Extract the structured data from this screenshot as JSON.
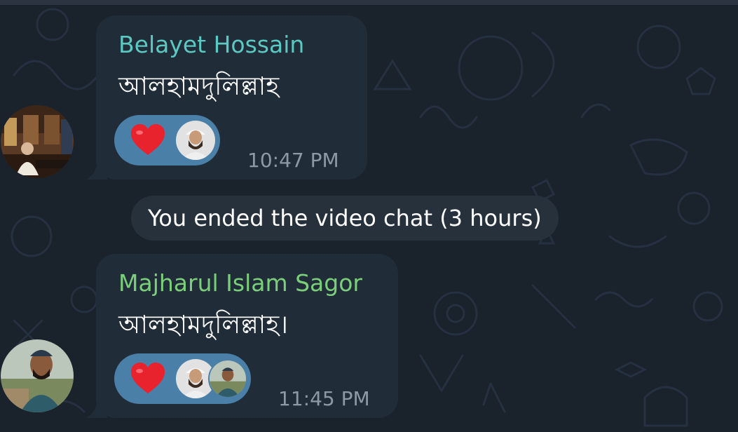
{
  "messages": [
    {
      "sender": "Belayet Hossain",
      "text": "আলহামদুলিল্লাহ",
      "time": "10:47 PM",
      "sender_color": "#5cc8c2",
      "reactions": {
        "emoji": "heart",
        "reactor_count": 1
      }
    },
    {
      "sender": "Majharul Islam Sagor",
      "text": "আলহামদুলিল্লাহ।",
      "time": "11:45 PM",
      "sender_color": "#7ccf7a",
      "reactions": {
        "emoji": "heart",
        "reactor_count": 2
      }
    }
  ],
  "service_message": "You ended the video chat (3 hours)",
  "colors": {
    "background": "#1a222c",
    "bubble": "#202c38",
    "reaction_pill": "#4a7fa8",
    "heart": "#e8232e",
    "time": "#8c99a6"
  }
}
